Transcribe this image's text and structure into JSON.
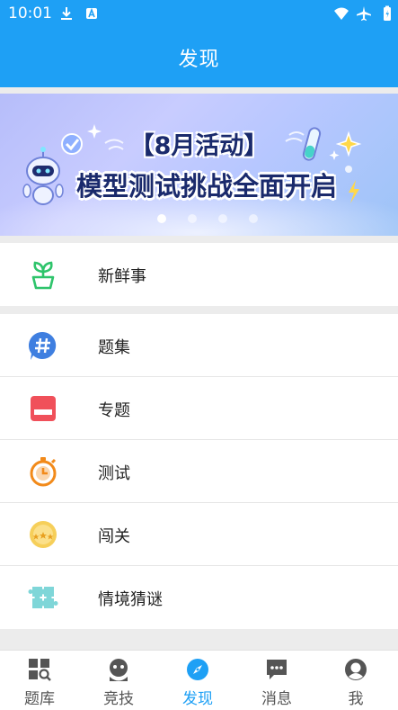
{
  "status_bar": {
    "time": "10:01"
  },
  "header": {
    "title": "发现"
  },
  "banner": {
    "line1": "【8月活动】",
    "line2": "模型测试挑战全面开启",
    "active_slide": 1,
    "slide_count": 4
  },
  "list": {
    "fresh": {
      "label": "新鲜事",
      "icon": "sprout-icon"
    },
    "items": [
      {
        "label": "题集",
        "icon": "hashtag-icon"
      },
      {
        "label": "专题",
        "icon": "topic-card-icon"
      },
      {
        "label": "测试",
        "icon": "stopwatch-icon"
      },
      {
        "label": "闯关",
        "icon": "stars-badge-icon"
      },
      {
        "label": "情境猜谜",
        "icon": "puzzle-icon"
      }
    ]
  },
  "bottom_nav": [
    {
      "label": "题库",
      "icon": "question-bank-icon",
      "active": false
    },
    {
      "label": "竞技",
      "icon": "compete-icon",
      "active": false
    },
    {
      "label": "发现",
      "icon": "compass-icon",
      "active": true
    },
    {
      "label": "消息",
      "icon": "message-icon",
      "active": false
    },
    {
      "label": "我",
      "icon": "profile-icon",
      "active": false
    }
  ],
  "colors": {
    "primary": "#1ea0f5",
    "background": "#ececec",
    "sprout": "#2ec46b",
    "hashtag": "#3f7fe0",
    "topic": "#f0505a",
    "stopwatch": "#f28a1a",
    "stars": "#e8b43a",
    "puzzle": "#7fd6d8"
  }
}
